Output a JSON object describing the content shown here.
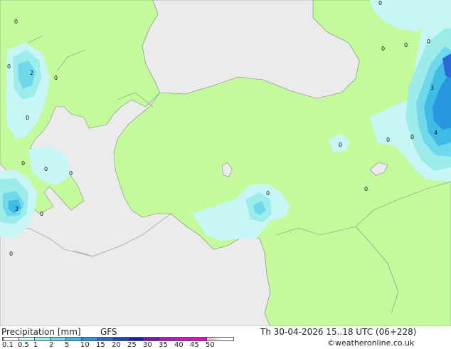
{
  "map": {
    "value_labels": [
      "0",
      "2",
      "0",
      "0",
      "0",
      "0",
      "0",
      "3",
      "0",
      "0",
      "0",
      "0",
      "0",
      "3",
      "4",
      "0",
      "0",
      "0",
      "0",
      "0",
      "0",
      "0"
    ]
  },
  "footer": {
    "product_label": "Precipitation [mm]",
    "model_label": "GFS",
    "datetime_label": "Th 30-04-2026 15..18 UTC (06+228)",
    "credit_label": "©weatheronline.co.uk",
    "legend": {
      "ticks": [
        "0.1",
        "0.5",
        "1",
        "2",
        "5",
        "10",
        "15",
        "20",
        "25",
        "30",
        "35",
        "40",
        "45",
        "50"
      ],
      "colors": [
        "#ffffff",
        "#c8f5f5",
        "#9cecec",
        "#6fd8ec",
        "#3ebce6",
        "#2996e0",
        "#2a6ad6",
        "#2046c4",
        "#1a22a8",
        "#7a14b4",
        "#b414c8",
        "#d40ed0",
        "#e60ccc",
        "#f0b4e8"
      ]
    }
  }
}
